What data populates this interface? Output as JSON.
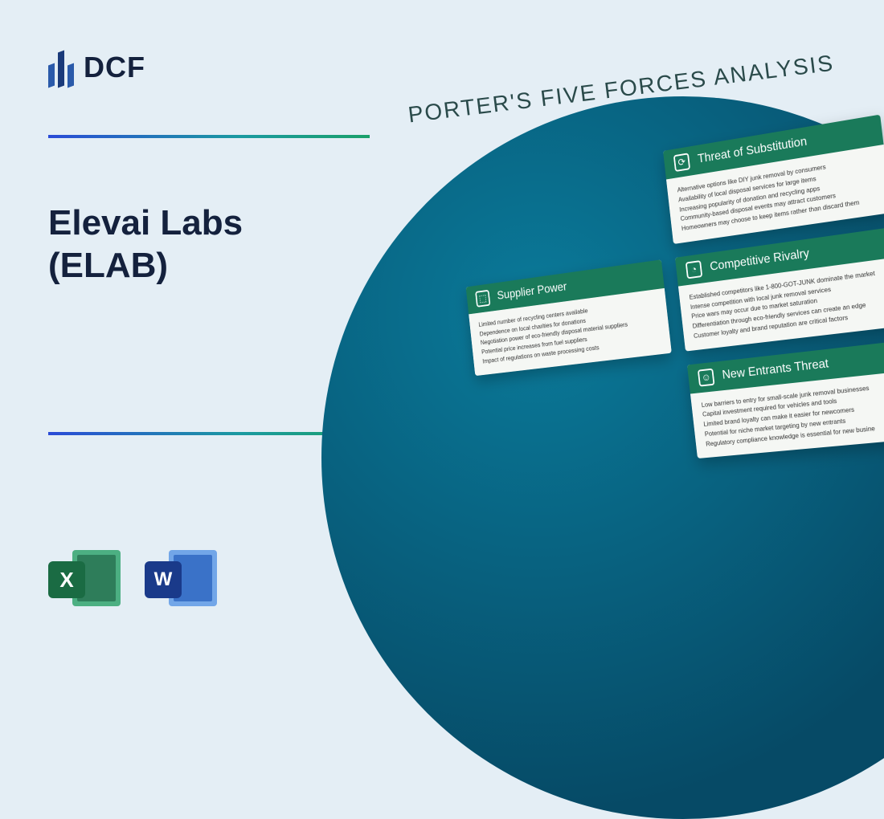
{
  "logo": {
    "text": "DCF"
  },
  "company": {
    "line1": "Elevai Labs",
    "line2": "(ELAB)"
  },
  "analysis_title": "PORTER'S FIVE FORCES ANALYSIS",
  "file_icons": {
    "excel_letter": "X",
    "word_letter": "W"
  },
  "cards": {
    "substitution": {
      "title": "Threat of Substitution",
      "items": [
        "Alternative options like DIY junk removal by consumers",
        "Availability of local disposal services for large items",
        "Increasing popularity of donation and recycling apps",
        "Community-based disposal events may attract customers",
        "Homeowners may choose to keep items rather than discard them"
      ]
    },
    "supplier": {
      "title": "Supplier Power",
      "items": [
        "Limited number of recycling centers available",
        "Dependence on local charities for donations",
        "Negotiation power of eco-friendly disposal material suppliers",
        "Potential price increases from fuel suppliers",
        "Impact of regulations on waste processing costs"
      ]
    },
    "rivalry": {
      "title": "Competitive Rivalry",
      "items": [
        "Established competitors like 1-800-GOT-JUNK dominate the market",
        "Intense competition with local junk removal services",
        "Price wars may occur due to market saturation",
        "Differentiation through eco-friendly services can create an edge",
        "Customer loyalty and brand reputation are critical factors"
      ]
    },
    "entrants": {
      "title": "New Entrants Threat",
      "items": [
        "Low barriers to entry for small-scale junk removal businesses",
        "Capital investment required for vehicles and tools",
        "Limited brand loyalty can make it easier for newcomers",
        "Potential for niche market targeting by new entrants",
        "Regulatory compliance knowledge is essential for new busine"
      ]
    }
  }
}
